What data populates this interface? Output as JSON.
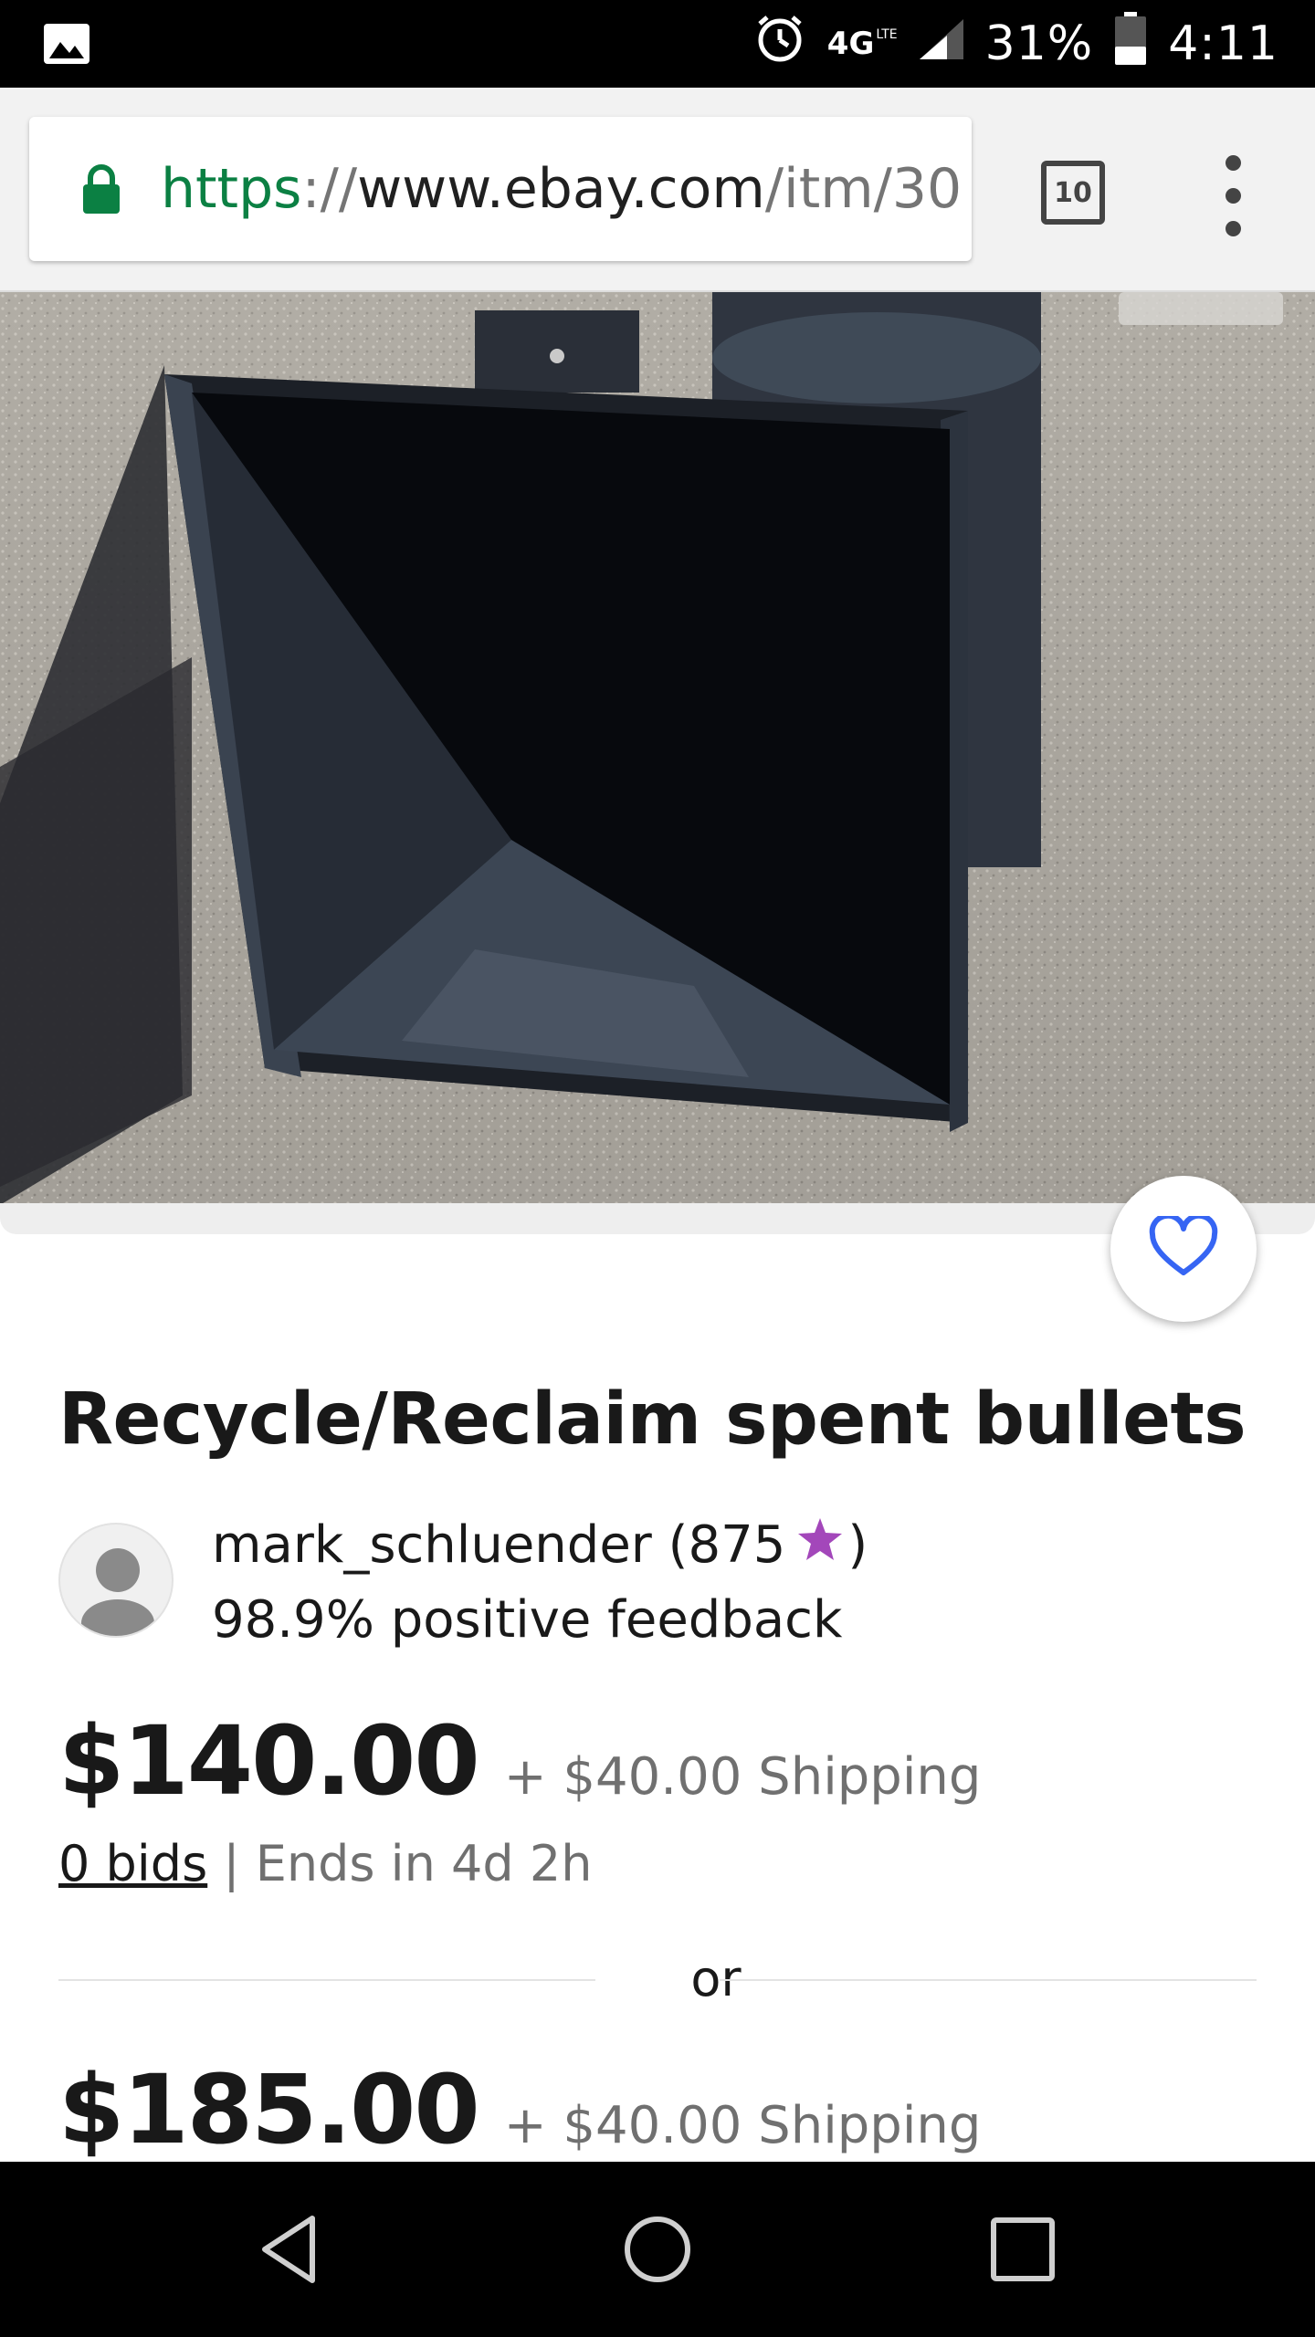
{
  "status_bar": {
    "network": "4G",
    "network_sub": "LTE",
    "battery": "31%",
    "time": "4:11",
    "icons": [
      "image-icon",
      "alarm-icon",
      "signal-icon",
      "battery-icon"
    ]
  },
  "browser": {
    "url_scheme": "https",
    "url_separator": "://",
    "url_host": "www.ebay.com",
    "url_path": "/itm/30",
    "tab_count": "10"
  },
  "listing": {
    "title": "Recycle/Reclaim spent bullets",
    "seller": {
      "name": "mark_schluender (875",
      "name_close": ")",
      "feedback": "98.9% positive feedback"
    },
    "auction": {
      "price": "$140.00",
      "shipping": "+ $40.00 Shipping",
      "bids": "0 bids",
      "ends": "| Ends in 4d 2h"
    },
    "divider_text": "or",
    "buy_it_now": {
      "price": "$185.00",
      "shipping": "+ $40.00 Shipping"
    }
  },
  "colors": {
    "secure_green": "#0b8043",
    "watch_blue": "#3665f3",
    "star_purple": "#a347ba"
  }
}
